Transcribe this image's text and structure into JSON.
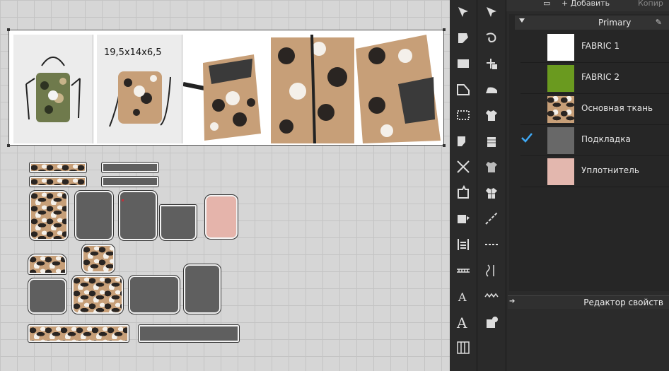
{
  "reference": {
    "dimensions_label": "19,5x14x6,5"
  },
  "toolbar": {
    "add_label": "+ Добавить",
    "copy_label": "Копир",
    "left_tools": [
      "select-icon",
      "fold-icon",
      "rectangle-icon",
      "polygon-icon",
      "dotted-rect-icon",
      "cut-shape-icon",
      "cross-tool-icon",
      "dart-icon",
      "seam-icon",
      "ruler-icon",
      "measure-icon",
      "text-small-icon",
      "text-large-icon",
      "grid-icon"
    ],
    "right_tools": [
      "pointer-icon",
      "spiral-icon",
      "pin-icon",
      "iron-icon",
      "tshirt-icon",
      "knit-icon",
      "pattern-icon",
      "plaid-icon",
      "line-icon",
      "dashed-line-icon",
      "stitch-icon",
      "zigzag-icon",
      "add-piece-icon"
    ]
  },
  "fabrics": {
    "group_label": "Primary",
    "items": [
      {
        "name": "FABRIC 1",
        "swatch": "#ffffff",
        "pattern": "plain",
        "selected": false
      },
      {
        "name": "FABRIC 2",
        "swatch": "#6a9a1f",
        "pattern": "plain",
        "selected": false
      },
      {
        "name": "Основная ткань",
        "swatch": "#c79f78",
        "pattern": "leopard",
        "selected": false
      },
      {
        "name": "Подкладка",
        "swatch": "#686868",
        "pattern": "plain",
        "selected": true
      },
      {
        "name": "Уплотнитель",
        "swatch": "#e3b7ae",
        "pattern": "plain",
        "selected": false
      }
    ]
  },
  "property_editor": {
    "label": "Редактор свойств"
  },
  "colors": {
    "check": "#3fa9f5",
    "panel_bg": "#2b2b2b",
    "leopard_base": "#c79f78"
  }
}
